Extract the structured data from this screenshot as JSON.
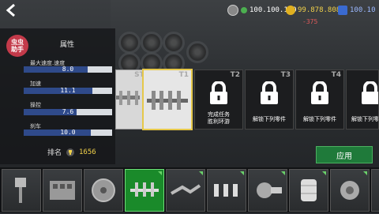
{
  "currency": {
    "cash": "100.100.100",
    "gold": "99.878.808",
    "gold_delta": "-375",
    "third": "100.10"
  },
  "panel": {
    "badge": "虫虫\n助手",
    "title": "属性",
    "stats": [
      {
        "label": "最大速度.速度",
        "value": "8.0",
        "fill": 0.72
      },
      {
        "label": "加速",
        "value": "11.1",
        "fill": 0.78
      },
      {
        "label": "操控",
        "value": "7.6",
        "fill": 0.6
      },
      {
        "label": "刹车",
        "value": "10.0",
        "fill": 0.76
      }
    ],
    "rank_label": "排名",
    "rank_value": "1656"
  },
  "cards": [
    {
      "tag": "STOCK",
      "state": "part"
    },
    {
      "tag": "T1",
      "state": "selected"
    },
    {
      "tag": "T2",
      "state": "locked",
      "text": "完成任务\n胜利环游"
    },
    {
      "tag": "T3",
      "state": "locked",
      "text": "解锁下列零件"
    },
    {
      "tag": "T4",
      "state": "locked",
      "text": "解锁下列零件"
    },
    {
      "tag": "",
      "state": "locked",
      "text": "解锁下列零"
    }
  ],
  "apply_label": "应用",
  "parts": [
    "piston",
    "engine-block",
    "flywheel",
    "crankshaft",
    "exhaust",
    "spark-plugs",
    "turbo",
    "air-filter",
    "supercharger",
    "ecu"
  ],
  "colors": {
    "gold": "#f2d24a",
    "delta": "#e05a5a",
    "active": "#1a8a2a"
  }
}
